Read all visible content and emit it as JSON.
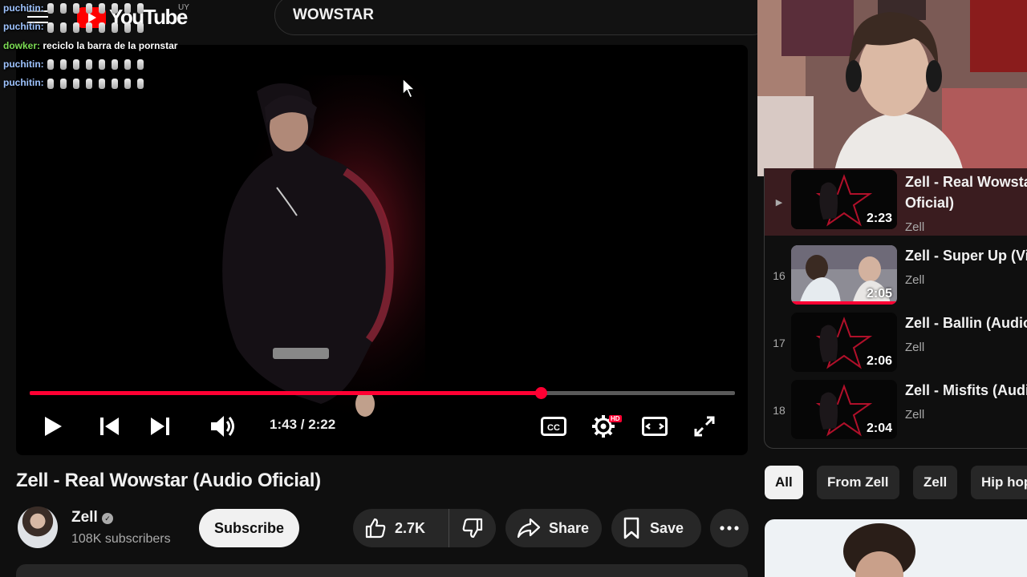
{
  "header": {
    "logo_text": "YouTube",
    "logo_country": "UY",
    "search_value": "WOWSTAR"
  },
  "chat": [
    {
      "user": "puchitin:",
      "message": "",
      "emotes": true
    },
    {
      "user": "puchitin:",
      "message": "",
      "emotes": true
    },
    {
      "user": "dowker:",
      "message": "reciclo la barra de la pornstar",
      "emotes": false
    },
    {
      "user": "puchitin:",
      "message": "",
      "emotes": true
    },
    {
      "user": "puchitin:",
      "message": "",
      "emotes": true
    }
  ],
  "player": {
    "progress_fraction": 0.725,
    "time_display": "1:43 / 2:22",
    "quality_badge": "HD"
  },
  "video": {
    "title": "Zell - Real Wowstar (Audio Oficial)",
    "channel": "Zell",
    "subscribers": "108K subscribers",
    "subscribe_label": "Subscribe",
    "likes": "2.7K",
    "share_label": "Share",
    "save_label": "Save"
  },
  "playlist": [
    {
      "index": "▶",
      "title": "Zell - Real Wowstar (Audio",
      "title2": "Oficial)",
      "channel": "Zell",
      "duration": "2:23",
      "current": true
    },
    {
      "index": "16",
      "title": "Zell - Super Up (Vid",
      "channel": "Zell",
      "duration": "2:05",
      "current": false
    },
    {
      "index": "17",
      "title": "Zell - Ballin (Audio",
      "channel": "Zell",
      "duration": "2:06",
      "current": false
    },
    {
      "index": "18",
      "title": "Zell - Misfits (Audio",
      "channel": "Zell",
      "duration": "2:04",
      "current": false
    }
  ],
  "chips": [
    "All",
    "From Zell",
    "Zell",
    "Hip hop"
  ],
  "colors": {
    "accent": "#ff0033",
    "background": "#0f0f0f",
    "pill": "#272727"
  }
}
